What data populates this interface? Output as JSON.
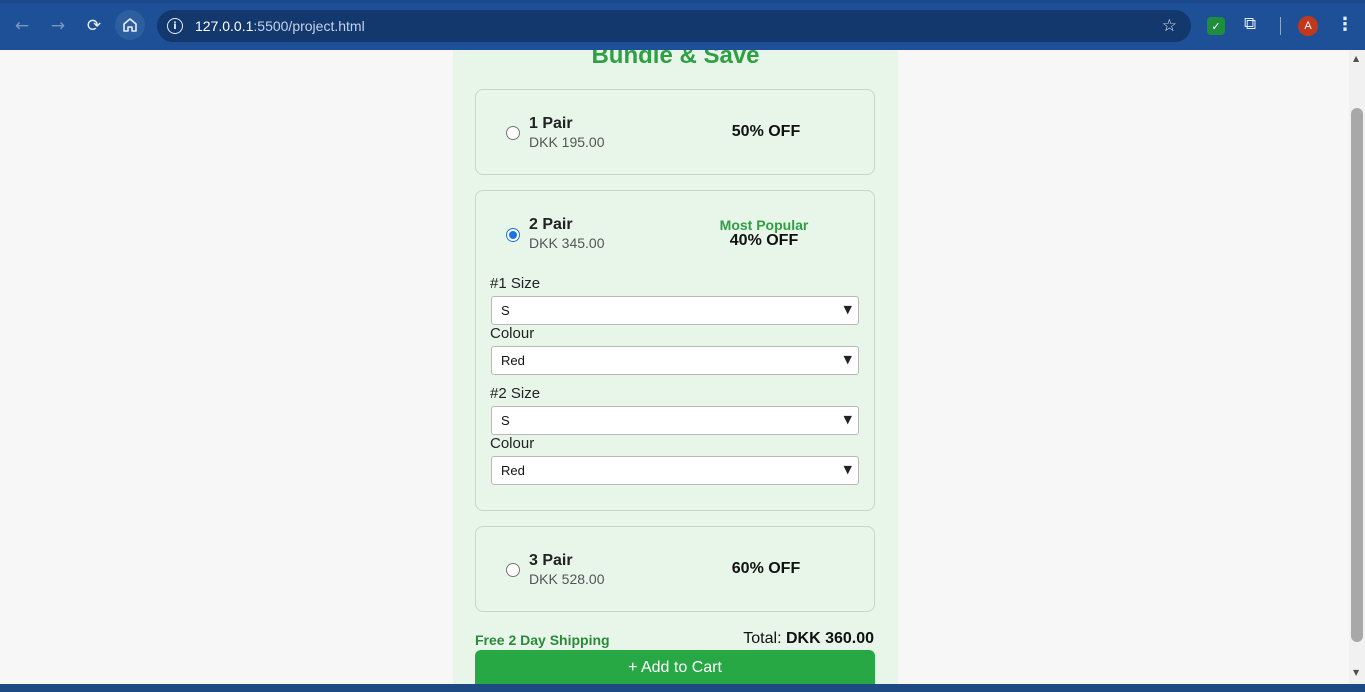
{
  "browser": {
    "url_host": "127.0.0.1",
    "url_rest": ":5500/project.html",
    "avatar_letter": "A"
  },
  "page": {
    "heading": "Bundle & Save",
    "options": [
      {
        "title": "1 Pair",
        "price": "DKK 195.00",
        "discount": "50% OFF",
        "selected": false
      },
      {
        "title": "2 Pair",
        "price": "DKK 345.00",
        "badge": "Most Popular",
        "discount": "40% OFF",
        "selected": true
      },
      {
        "title": "3 Pair",
        "price": "DKK 528.00",
        "discount": "60% OFF",
        "selected": false
      }
    ],
    "selectors": {
      "size1_label": "#1 Size",
      "size1_value": "S",
      "colour1_label": "Colour",
      "colour1_value": "Red",
      "size2_label": "#2 Size",
      "size2_value": "S",
      "colour2_label": "Colour",
      "colour2_value": "Red"
    },
    "shipping": "Free 2 Day Shipping",
    "total_label": "Total: ",
    "total_value": "DKK 360.00",
    "add_to_cart": "+ Add to Cart"
  },
  "colors": {
    "accent_green": "#2ea043",
    "button_green": "#28a745",
    "panel_bg": "#e8f5e9",
    "chrome_blue": "#1d5096"
  }
}
